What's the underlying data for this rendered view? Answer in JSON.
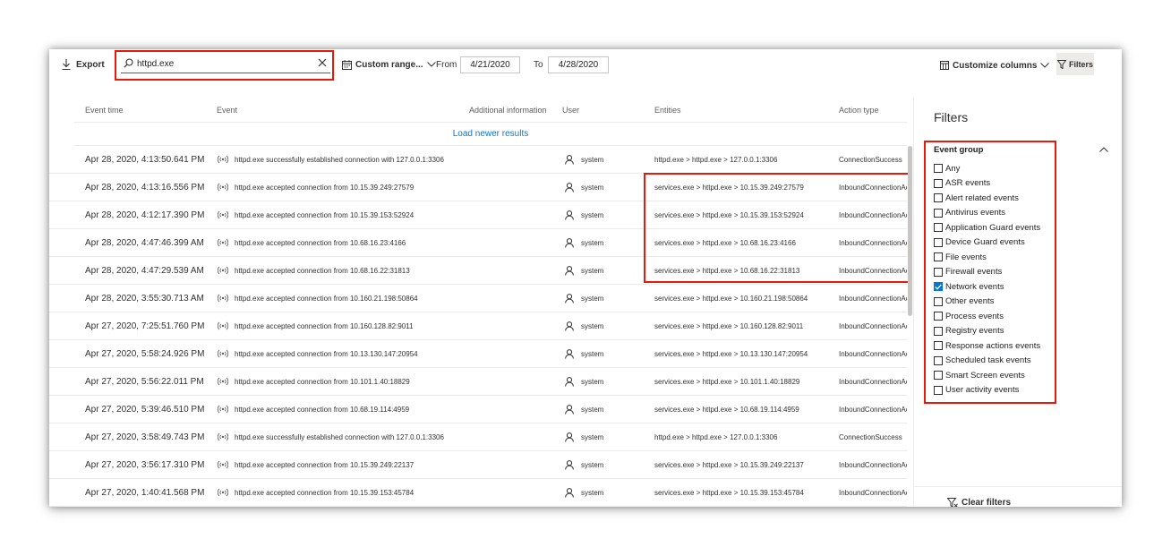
{
  "toolbar": {
    "export_label": "Export",
    "search": {
      "value": "httpd.exe",
      "placeholder": ""
    },
    "range_label": "Custom range...",
    "from_label": "From",
    "from_date": "4/21/2020",
    "to_label": "To",
    "to_date": "4/28/2020",
    "customize_label": "Customize columns",
    "filters_label": "Filters"
  },
  "table": {
    "headers": {
      "time": "Event time",
      "event": "Event",
      "info": "Additional information",
      "user": "User",
      "entities": "Entities",
      "action": "Action type"
    },
    "load_newer": "Load newer results",
    "rows": [
      {
        "time": "Apr 28, 2020, 4:13:50.641 PM",
        "event": "httpd.exe successfully established connection with 127.0.0.1:3306",
        "user": "system",
        "entities": "httpd.exe > httpd.exe > 127.0.0.1:3306",
        "action": "ConnectionSuccess"
      },
      {
        "time": "Apr 28, 2020, 4:13:16.556 PM",
        "event": "httpd.exe accepted connection from 10.15.39.249:27579",
        "user": "system",
        "entities": "services.exe > httpd.exe > 10.15.39.249:27579",
        "action": "InboundConnectionAccepted"
      },
      {
        "time": "Apr 28, 2020, 4:12:17.390 PM",
        "event": "httpd.exe accepted connection from 10.15.39.153:52924",
        "user": "system",
        "entities": "services.exe > httpd.exe > 10.15.39.153:52924",
        "action": "InboundConnectionAccepted"
      },
      {
        "time": "Apr 28, 2020, 4:47:46.399 AM",
        "event": "httpd.exe accepted connection from 10.68.16.23:4166",
        "user": "system",
        "entities": "services.exe > httpd.exe > 10.68.16.23:4166",
        "action": "InboundConnectionAccepted"
      },
      {
        "time": "Apr 28, 2020, 4:47:29.539 AM",
        "event": "httpd.exe accepted connection from 10.68.16.22:31813",
        "user": "system",
        "entities": "services.exe > httpd.exe > 10.68.16.22:31813",
        "action": "InboundConnectionAccepted"
      },
      {
        "time": "Apr 28, 2020, 3:55:30.713 AM",
        "event": "httpd.exe accepted connection from 10.160.21.198:50864",
        "user": "system",
        "entities": "services.exe > httpd.exe > 10.160.21.198:50864",
        "action": "InboundConnectionAccepted"
      },
      {
        "time": "Apr 27, 2020, 7:25:51.760 PM",
        "event": "httpd.exe accepted connection from 10.160.128.82:9011",
        "user": "system",
        "entities": "services.exe > httpd.exe > 10.160.128.82:9011",
        "action": "InboundConnectionAccepted"
      },
      {
        "time": "Apr 27, 2020, 5:58:24.926 PM",
        "event": "httpd.exe accepted connection from 10.13.130.147:20954",
        "user": "system",
        "entities": "services.exe > httpd.exe > 10.13.130.147:20954",
        "action": "InboundConnectionAccepted"
      },
      {
        "time": "Apr 27, 2020, 5:56:22.011 PM",
        "event": "httpd.exe accepted connection from 10.101.1.40:18829",
        "user": "system",
        "entities": "services.exe > httpd.exe > 10.101.1.40:18829",
        "action": "InboundConnectionAccepted"
      },
      {
        "time": "Apr 27, 2020, 5:39:46.510 PM",
        "event": "httpd.exe accepted connection from 10.68.19.114:4959",
        "user": "system",
        "entities": "services.exe > httpd.exe > 10.68.19.114:4959",
        "action": "InboundConnectionAccepted"
      },
      {
        "time": "Apr 27, 2020, 3:58:49.743 PM",
        "event": "httpd.exe successfully established connection with 127.0.0.1:3306",
        "user": "system",
        "entities": "httpd.exe > httpd.exe > 127.0.0.1:3306",
        "action": "ConnectionSuccess"
      },
      {
        "time": "Apr 27, 2020, 3:56:17.310 PM",
        "event": "httpd.exe accepted connection from 10.15.39.249:22137",
        "user": "system",
        "entities": "services.exe > httpd.exe > 10.15.39.249:22137",
        "action": "InboundConnectionAccepted"
      },
      {
        "time": "Apr 27, 2020, 1:40:41.568 PM",
        "event": "httpd.exe accepted connection from 10.15.39.153:45784",
        "user": "system",
        "entities": "services.exe > httpd.exe > 10.15.39.153:45784",
        "action": "InboundConnectionAccepted"
      }
    ]
  },
  "filters": {
    "title": "Filters",
    "group_title": "Event group",
    "items": [
      {
        "label": "Any",
        "checked": false
      },
      {
        "label": "ASR events",
        "checked": false
      },
      {
        "label": "Alert related events",
        "checked": false
      },
      {
        "label": "Antivirus events",
        "checked": false
      },
      {
        "label": "Application Guard events",
        "checked": false
      },
      {
        "label": "Device Guard events",
        "checked": false
      },
      {
        "label": "File events",
        "checked": false
      },
      {
        "label": "Firewall events",
        "checked": false
      },
      {
        "label": "Network events",
        "checked": true
      },
      {
        "label": "Other events",
        "checked": false
      },
      {
        "label": "Process events",
        "checked": false
      },
      {
        "label": "Registry events",
        "checked": false
      },
      {
        "label": "Response actions events",
        "checked": false
      },
      {
        "label": "Scheduled task events",
        "checked": false
      },
      {
        "label": "Smart Screen events",
        "checked": false
      },
      {
        "label": "User activity events",
        "checked": false
      }
    ],
    "clear_label": "Clear filters"
  },
  "colors": {
    "accent": "#0078d4",
    "highlight": "#e8190a",
    "border": "#edebe9"
  },
  "icons": {
    "event": "network-signal-icon",
    "user": "person-icon"
  }
}
